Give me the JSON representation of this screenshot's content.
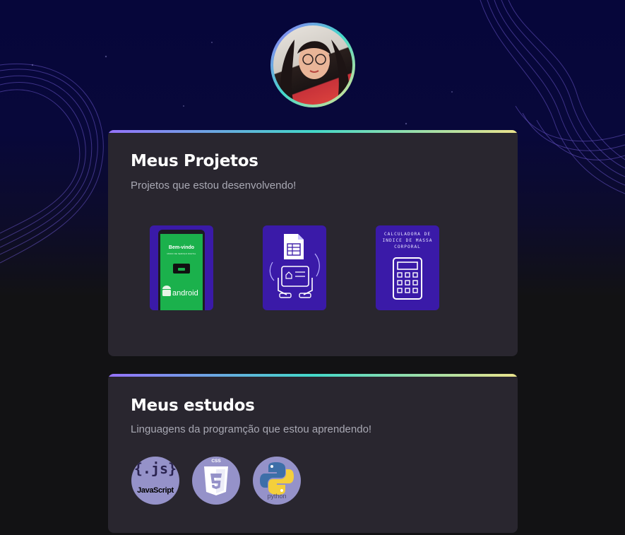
{
  "profile": {
    "avatar_icon": "profile-photo"
  },
  "projects": {
    "title": "Meus Projetos",
    "subtitle": "Projetos que estou desenvolvendo!",
    "items": [
      {
        "icon": "android-app-icon",
        "welcome_text": "Bem-vindo",
        "small_text": "MODO DE SERVIÇO DIGITAL",
        "os_text": "android"
      },
      {
        "icon": "spreadsheet-tablet-icon"
      },
      {
        "icon": "calculator-icon",
        "caption": "CALCULADORA DE INDICE DE MASSA CORPORAL"
      }
    ]
  },
  "studies": {
    "title": "Meus estudos",
    "subtitle": "Linguagens da programção que estou aprendendo!",
    "items": [
      {
        "icon": "javascript-icon",
        "label": "{.js}",
        "name": "JavaScript"
      },
      {
        "icon": "css3-icon",
        "label": "CSS",
        "shield_digit": "3"
      },
      {
        "icon": "python-icon",
        "name": "python"
      }
    ]
  },
  "colors": {
    "background": "#121214",
    "card": "#29262f",
    "accent_gradient": [
      "#9572fc",
      "#43d8c9",
      "#ebe38c"
    ],
    "project_tile": "#3a1aa8",
    "tech_circle": "#9592c9"
  }
}
